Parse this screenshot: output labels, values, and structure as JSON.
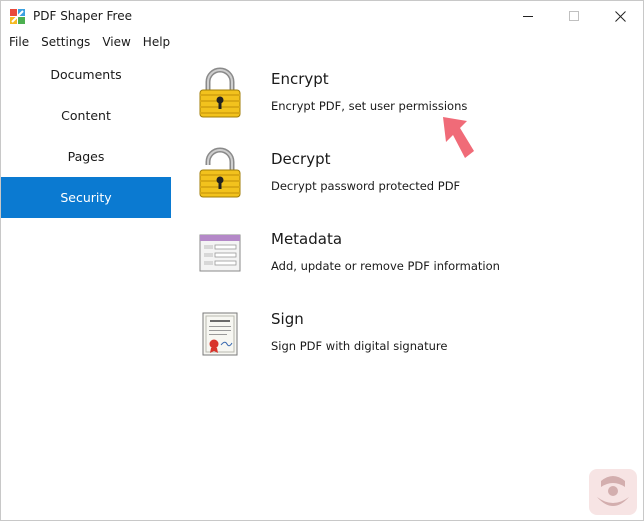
{
  "window": {
    "title": "PDF Shaper Free"
  },
  "menu": {
    "items": [
      "File",
      "Settings",
      "View",
      "Help"
    ]
  },
  "sidebar": {
    "items": [
      {
        "label": "Documents"
      },
      {
        "label": "Content"
      },
      {
        "label": "Pages"
      },
      {
        "label": "Security"
      }
    ],
    "active_index": 3
  },
  "features": [
    {
      "title": "Encrypt",
      "description": "Encrypt PDF, set user permissions",
      "icon": "lock-icon"
    },
    {
      "title": "Decrypt",
      "description": "Decrypt password protected PDF",
      "icon": "unlock-icon"
    },
    {
      "title": "Metadata",
      "description": "Add, update or remove PDF information",
      "icon": "metadata-form-icon"
    },
    {
      "title": "Sign",
      "description": "Sign PDF with digital signature",
      "icon": "certificate-icon"
    }
  ],
  "colors": {
    "accent": "#0b7ad1",
    "lock_gold": "#f2c21d",
    "arrow": "#f06b78"
  }
}
